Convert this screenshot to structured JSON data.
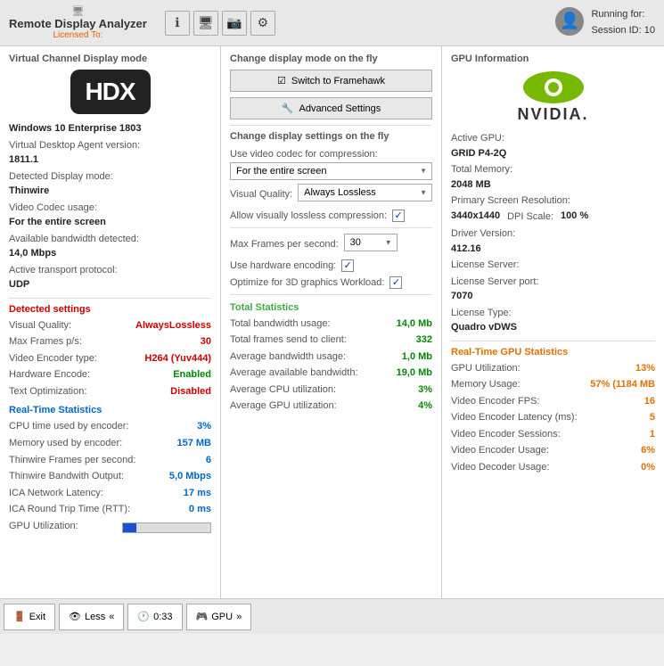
{
  "app": {
    "title": "Remote Display Analyzer",
    "licensed_label": "Licensed To:"
  },
  "session": {
    "running_for_label": "Running for:",
    "session_id_label": "Session ID:",
    "session_id_value": "10"
  },
  "toolbar": {
    "btn1": "ℹ",
    "btn2": "🖥",
    "btn3": "📷",
    "btn4": "⚙"
  },
  "left_panel": {
    "section_title": "Virtual Channel Display mode",
    "hdx_logo": "HDX",
    "os_label": "Windows 10 Enterprise 1803",
    "vda_version_label": "Virtual Desktop Agent version:",
    "vda_version_value": "1811.1",
    "detected_display_label": "Detected Display mode:",
    "detected_display_value": "Thinwire",
    "video_codec_label": "Video Codec usage:",
    "video_codec_value": "For the entire screen",
    "bandwidth_label": "Available bandwidth detected:",
    "bandwidth_value": "14,0 Mbps",
    "transport_label": "Active transport protocol:",
    "transport_value": "UDP",
    "detected_section": "Detected settings",
    "visual_quality_label": "Visual Quality:",
    "visual_quality_value": "AlwaysLossless",
    "max_frames_label": "Max Frames p/s:",
    "max_frames_value": "30",
    "encoder_type_label": "Video Encoder type:",
    "encoder_type_value": "H264 (Yuv444)",
    "hw_encode_label": "Hardware Encode:",
    "hw_encode_value": "Enabled",
    "text_opt_label": "Text Optimization:",
    "text_opt_value": "Disabled",
    "realtime_section": "Real-Time Statistics",
    "cpu_encoder_label": "CPU time used by encoder:",
    "cpu_encoder_value": "3%",
    "memory_encoder_label": "Memory used by encoder:",
    "memory_encoder_value": "157 MB",
    "thinwire_fps_label": "Thinwire Frames per second:",
    "thinwire_fps_value": "6",
    "thinwire_bw_label": "Thinwire Bandwith Output:",
    "thinwire_bw_value": "5,0 Mbps",
    "ica_latency_label": "ICA Network Latency:",
    "ica_latency_value": "17 ms",
    "ica_rtt_label": "ICA Round Trip Time (RTT):",
    "ica_rtt_value": "0 ms",
    "gpu_util_label": "GPU Utilization:",
    "gpu_util_bar_percent": 15
  },
  "mid_panel": {
    "top_section_title": "Change display mode on the fly",
    "framehawk_btn": "Switch to Framehawk",
    "advanced_btn": "Advanced Settings",
    "bottom_section_title": "Change display settings on the fly",
    "codec_label": "Use video codec for compression:",
    "codec_value": "For the entire screen",
    "visual_quality_label": "Visual Quality:",
    "visual_quality_value": "Always Lossless",
    "lossless_label": "Allow visually lossless compression:",
    "lossless_checked": true,
    "max_fps_label": "Max Frames per second:",
    "max_fps_value": "30",
    "hw_encoding_label": "Use hardware encoding:",
    "hw_encoding_checked": true,
    "optimize_3d_label": "Optimize for 3D graphics Workload:",
    "optimize_3d_checked": true,
    "total_stats_title": "Total Statistics",
    "bw_usage_label": "Total bandwidth usage:",
    "bw_usage_value": "14,0 Mb",
    "frames_sent_label": "Total frames send to client:",
    "frames_sent_value": "332",
    "avg_bw_label": "Average bandwidth usage:",
    "avg_bw_value": "1,0 Mb",
    "avg_avail_bw_label": "Average available bandwidth:",
    "avg_avail_bw_value": "19,0 Mb",
    "avg_cpu_label": "Average CPU utilization:",
    "avg_cpu_value": "3%",
    "avg_gpu_label": "Average GPU utilization:",
    "avg_gpu_value": "4%"
  },
  "right_panel": {
    "section_title": "GPU Information",
    "active_gpu_label": "Active GPU:",
    "active_gpu_value": "GRID P4-2Q",
    "total_memory_label": "Total Memory:",
    "total_memory_value": "2048 MB",
    "resolution_label": "Primary Screen Resolution:",
    "resolution_value": "3440x1440",
    "dpi_label": "DPI Scale:",
    "dpi_value": "100 %",
    "driver_label": "Driver Version:",
    "driver_value": "412.16",
    "license_server_label": "License Server:",
    "license_server_value": "",
    "license_port_label": "License Server port:",
    "license_port_value": "7070",
    "license_type_label": "License Type:",
    "license_type_value": "Quadro vDWS",
    "gpu_stats_title": "Real-Time GPU Statistics",
    "gpu_util_label": "GPU Utilization:",
    "gpu_util_value": "13%",
    "mem_usage_label": "Memory Usage:",
    "mem_usage_value": "57% (1184 MB",
    "encoder_fps_label": "Video Encoder FPS:",
    "encoder_fps_value": "16",
    "encoder_latency_label": "Video Encoder Latency (ms):",
    "encoder_latency_value": "5",
    "encoder_sessions_label": "Video Encoder Sessions:",
    "encoder_sessions_value": "1",
    "encoder_usage_label": "Video Encoder Usage:",
    "encoder_usage_value": "6%",
    "decoder_usage_label": "Video Decoder Usage:",
    "decoder_usage_value": "0%"
  },
  "bottom_bar": {
    "exit_label": "Exit",
    "less_label": "Less",
    "timer_label": "0:33",
    "gpu_label": "GPU"
  }
}
